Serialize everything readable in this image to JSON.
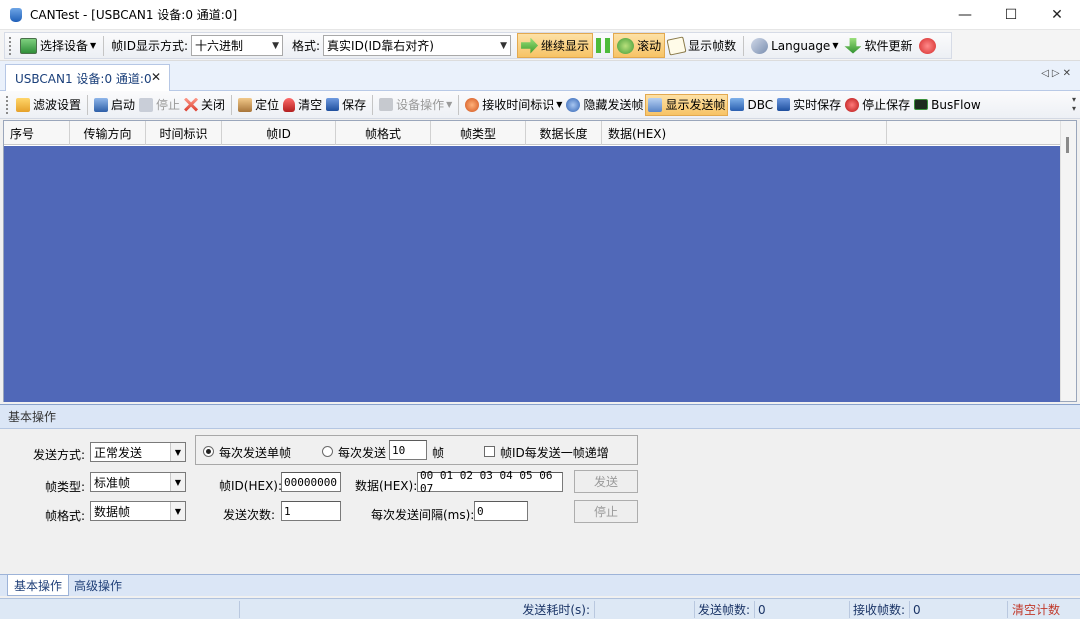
{
  "window": {
    "title": "CANTest  - [USBCAN1 设备:0 通道:0]",
    "controls": {
      "minimize": "—",
      "maximize": "☐",
      "close": "✕"
    }
  },
  "toolbar": {
    "select_device": "选择设备",
    "frame_id_format_label": "帧ID显示方式:",
    "frame_id_format_value": "十六进制",
    "format_label": "格式:",
    "format_value": "真实ID(ID靠右对齐)",
    "continue_display": "继续显示",
    "scroll": "滚动",
    "show_frame_count": "显示帧数",
    "language": "Language",
    "software_update": "软件更新"
  },
  "doc_tab": {
    "label": "USBCAN1 设备:0 通道:0",
    "close": "✕"
  },
  "toolbar2": {
    "filter_settings": "滤波设置",
    "start": "启动",
    "stop": "停止",
    "close": "关闭",
    "locate": "定位",
    "clear": "清空",
    "save": "保存",
    "device_ops": "设备操作",
    "rx_timestamp": "接收时间标识",
    "hide_sent_frames": "隐藏发送帧",
    "show_sent_frames": "显示发送帧",
    "dbc": "DBC",
    "realtime_save": "实时保存",
    "stop_save": "停止保存",
    "busflow": "BusFlow"
  },
  "grid": {
    "columns": [
      "序号",
      "传输方向",
      "时间标识",
      "帧ID",
      "帧格式",
      "帧类型",
      "数据长度",
      "数据(HEX)"
    ],
    "rows": []
  },
  "send_panel": {
    "header": "基本操作",
    "send_mode_label": "发送方式:",
    "send_mode_value": "正常发送",
    "frame_type_label": "帧类型:",
    "frame_type_value": "标准帧",
    "frame_format_label": "帧格式:",
    "frame_format_value": "数据帧",
    "radio_single": "每次发送单帧",
    "radio_multi": "每次发送",
    "multi_count": "10",
    "frame_unit": "帧",
    "increment_id_label": "帧ID每发送一帧递增",
    "frame_id_label": "帧ID(HEX):",
    "frame_id_value": "00000000",
    "data_label": "数据(HEX):",
    "data_value": "00 01 02 03 04 05 06 07",
    "send_count_label": "发送次数:",
    "send_count_value": "1",
    "interval_label": "每次发送间隔(ms):",
    "interval_value": "0",
    "send_button": "发送",
    "stop_button": "停止"
  },
  "bottom_tabs": [
    "基本操作",
    "高级操作"
  ],
  "status": {
    "send_time_label": "发送耗时(s):",
    "send_time_value": "",
    "sent_frames_label": "发送帧数:",
    "sent_frames_value": "0",
    "received_frames_label": "接收帧数:",
    "received_frames_value": "0",
    "clear_count": "清空计数"
  },
  "colors": {
    "grid_background": "#5068b8",
    "highlight": "#f7c365",
    "panel_header": "#dbe6f6",
    "clear_count_text": "#c0392b"
  }
}
